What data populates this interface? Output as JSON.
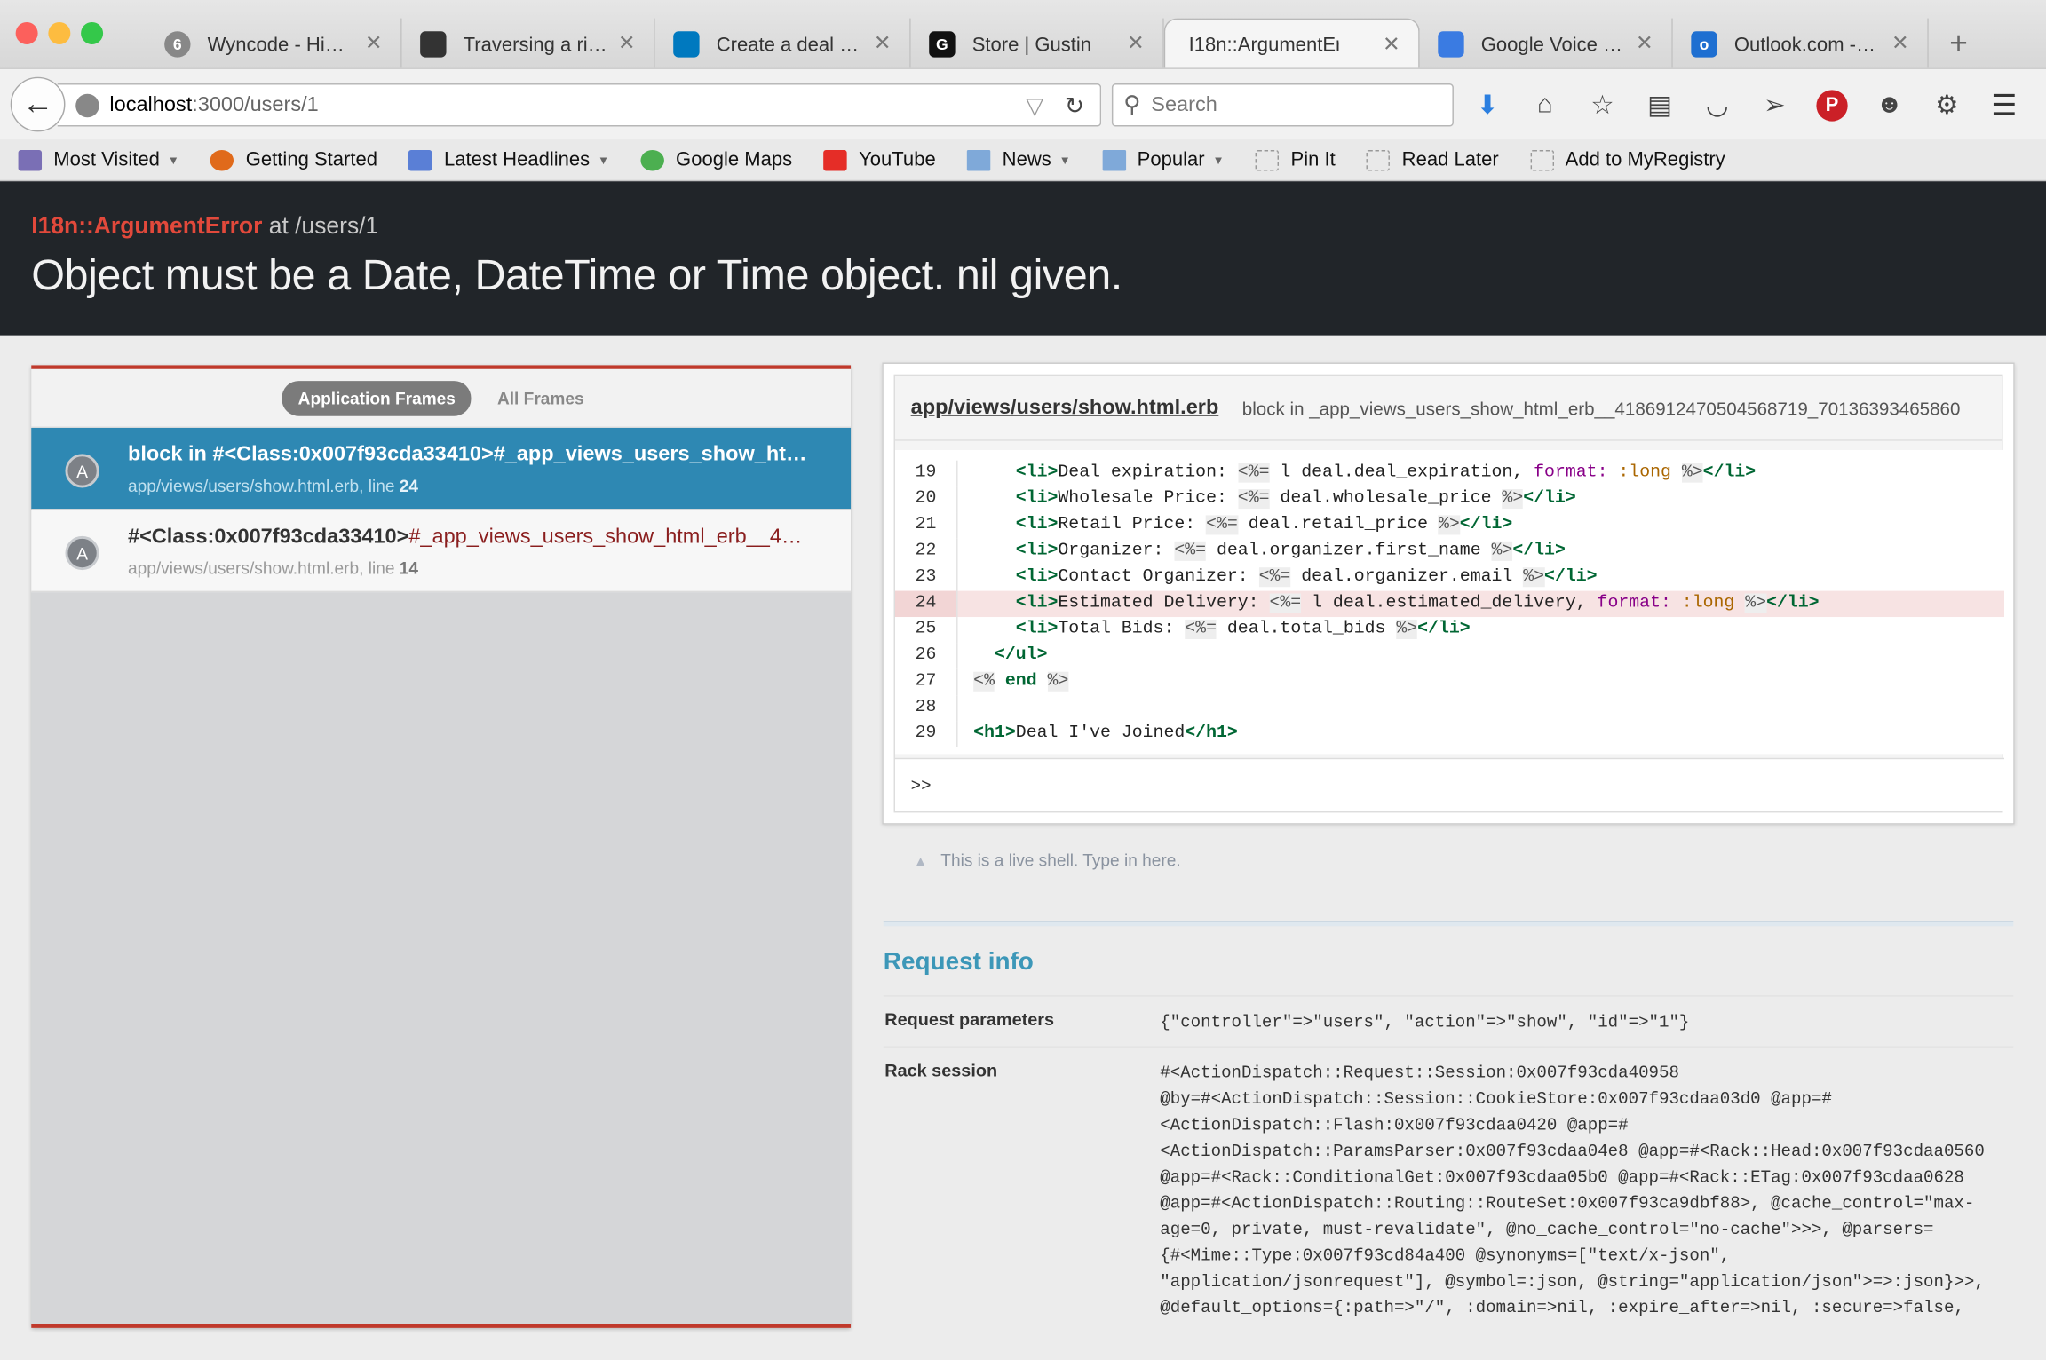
{
  "tabs": [
    {
      "label": "Wyncode - Hi…",
      "icon": "badge-icon",
      "badge": "6",
      "color": "#888888"
    },
    {
      "label": "Traversing a ri…",
      "icon": "github-icon",
      "color": "#333333"
    },
    {
      "label": "Create a deal …",
      "icon": "trello-icon",
      "color": "#0079bf"
    },
    {
      "label": "Store | Gustin",
      "icon": "gustin-icon",
      "glyph": "G",
      "color": "#111111"
    },
    {
      "label": "I18n::ArgumentErr…",
      "icon": "",
      "color": "",
      "active": true
    },
    {
      "label": "Google Voice …",
      "icon": "phone-icon",
      "color": "#3a7be2"
    },
    {
      "label": "Outlook.com -…",
      "icon": "outlook-icon",
      "glyph": "o",
      "color": "#1e6fd1"
    }
  ],
  "urlbar": {
    "host": "localhost",
    "rest": ":3000/users/1"
  },
  "search": {
    "placeholder": "Search"
  },
  "bookmarks": [
    {
      "label": "Most Visited",
      "caret": true,
      "icon": "most-visited-icon",
      "color": "#7a6fb5"
    },
    {
      "label": "Getting Started",
      "caret": false,
      "icon": "firefox-icon",
      "color": "#e06a1b"
    },
    {
      "label": "Latest Headlines",
      "caret": true,
      "icon": "rss-icon",
      "color": "#5a7fd6"
    },
    {
      "label": "Google Maps",
      "caret": false,
      "icon": "maps-icon",
      "color": "#4caf50"
    },
    {
      "label": "YouTube",
      "caret": false,
      "icon": "youtube-icon",
      "color": "#e52d27"
    },
    {
      "label": "News",
      "caret": true,
      "icon": "folder-icon",
      "color": "#7fa9d9"
    },
    {
      "label": "Popular",
      "caret": true,
      "icon": "folder-icon",
      "color": "#7fa9d9"
    },
    {
      "label": "Pin It",
      "caret": false,
      "icon": "dashed-icon",
      "color": ""
    },
    {
      "label": "Read Later",
      "caret": false,
      "icon": "dashed-icon",
      "color": ""
    },
    {
      "label": "Add to MyRegistry",
      "caret": false,
      "icon": "dashed-icon",
      "color": ""
    }
  ],
  "error": {
    "exception": "I18n::ArgumentError",
    "at": " at /users/1",
    "message": "Object must be a Date, DateTime or Time object. nil given."
  },
  "frames_panel": {
    "tab_app": "Application Frames",
    "tab_all": "All Frames",
    "frames": [
      {
        "avatar": "A",
        "name": "block in #<Class:0x007f93cda33410>#_app_views_users_show_ht…",
        "context": "",
        "file": "app/views/users/show.html.erb, line ",
        "line": "24",
        "selected": true
      },
      {
        "avatar": "A",
        "name": "#<Class:0x007f93cda33410>",
        "context": "#_app_views_users_show_html_erb__4…",
        "file": "app/views/users/show.html.erb, line ",
        "line": "14",
        "selected": false
      }
    ]
  },
  "code": {
    "file": "app/views/users/show.html.erb",
    "block": "block in _app_views_users_show_html_erb__4186912470504568719_70136393465860",
    "highlight_line": "24",
    "lines": [
      {
        "n": "19",
        "text": "    <li>Deal expiration: <%= l deal.deal_expiration, format: :long %></li>"
      },
      {
        "n": "20",
        "text": "    <li>Wholesale Price: <%= deal.wholesale_price %></li>"
      },
      {
        "n": "21",
        "text": "    <li>Retail Price: <%= deal.retail_price %></li>"
      },
      {
        "n": "22",
        "text": "    <li>Organizer: <%= deal.organizer.first_name %></li>"
      },
      {
        "n": "23",
        "text": "    <li>Contact Organizer: <%= deal.organizer.email %></li>"
      },
      {
        "n": "24",
        "text": "    <li>Estimated Delivery: <%= l deal.estimated_delivery, format: :long %></li>"
      },
      {
        "n": "25",
        "text": "    <li>Total Bids: <%= deal.total_bids %></li>"
      },
      {
        "n": "26",
        "text": "  </ul>"
      },
      {
        "n": "27",
        "text": "<% end %>"
      },
      {
        "n": "28",
        "text": ""
      },
      {
        "n": "29",
        "text": "<h1>Deal I've Joined</h1>"
      }
    ],
    "shell_prompt": ">>"
  },
  "shell_hint": "This is a live shell. Type in here.",
  "request_info": {
    "title": "Request info",
    "params_label": "Request parameters",
    "params_value": "{\"controller\"=>\"users\", \"action\"=>\"show\", \"id\"=>\"1\"}",
    "session_label": "Rack session",
    "session_value": "#<ActionDispatch::Request::Session:0x007f93cda40958\n@by=#<ActionDispatch::Session::CookieStore:0x007f93cdaa03d0 @app=#\n<ActionDispatch::Flash:0x007f93cdaa0420 @app=#\n<ActionDispatch::ParamsParser:0x007f93cdaa04e8 @app=#<Rack::Head:0x007f93cdaa0560\n@app=#<Rack::ConditionalGet:0x007f93cdaa05b0 @app=#<Rack::ETag:0x007f93cdaa0628\n@app=#<ActionDispatch::Routing::RouteSet:0x007f93ca9dbf88>, @cache_control=\"max-\nage=0, private, must-revalidate\", @no_cache_control=\"no-cache\">>>, @parsers=\n{#<Mime::Type:0x007f93cd84a400 @synonyms=[\"text/x-json\",\n\"application/jsonrequest\"], @symbol=:json, @string=\"application/json\">=>:json}>>,\n@default_options={:path=>\"/\", :domain=>nil, :expire_after=>nil, :secure=>false,"
  },
  "colors": {
    "accent": "#2e88b3",
    "error": "#e2493b",
    "header_bg": "#212529",
    "request_title": "#3c97b8"
  }
}
